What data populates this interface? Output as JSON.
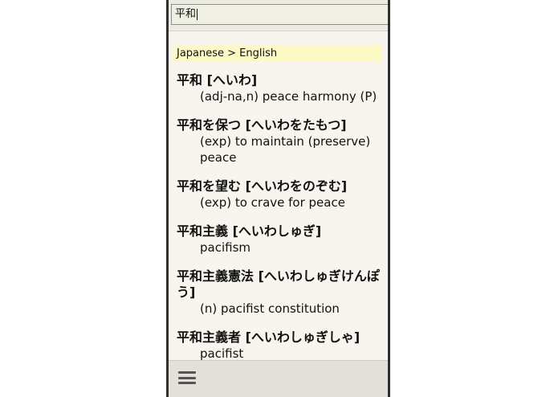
{
  "search": {
    "value": "平和"
  },
  "direction_label": "Japanese > English",
  "entries": [
    {
      "term": "平和 [へいわ]",
      "definition": "(adj-na,n) peace harmony (P)"
    },
    {
      "term": "平和を保つ [へいわをたもつ]",
      "definition": "(exp) to maintain (preserve) peace"
    },
    {
      "term": "平和を望む [へいわをのぞむ]",
      "definition": "(exp) to crave for peace"
    },
    {
      "term": "平和主義 [へいわしゅぎ]",
      "definition": "pacifism"
    },
    {
      "term": "平和主義憲法 [へいわしゅぎけんぽう]",
      "definition": "(n) pacifist constitution"
    },
    {
      "term": "平和主義者 [へいわしゅぎしゃ]",
      "definition": "pacifist"
    }
  ],
  "icons": {
    "menu": "menu-icon"
  }
}
